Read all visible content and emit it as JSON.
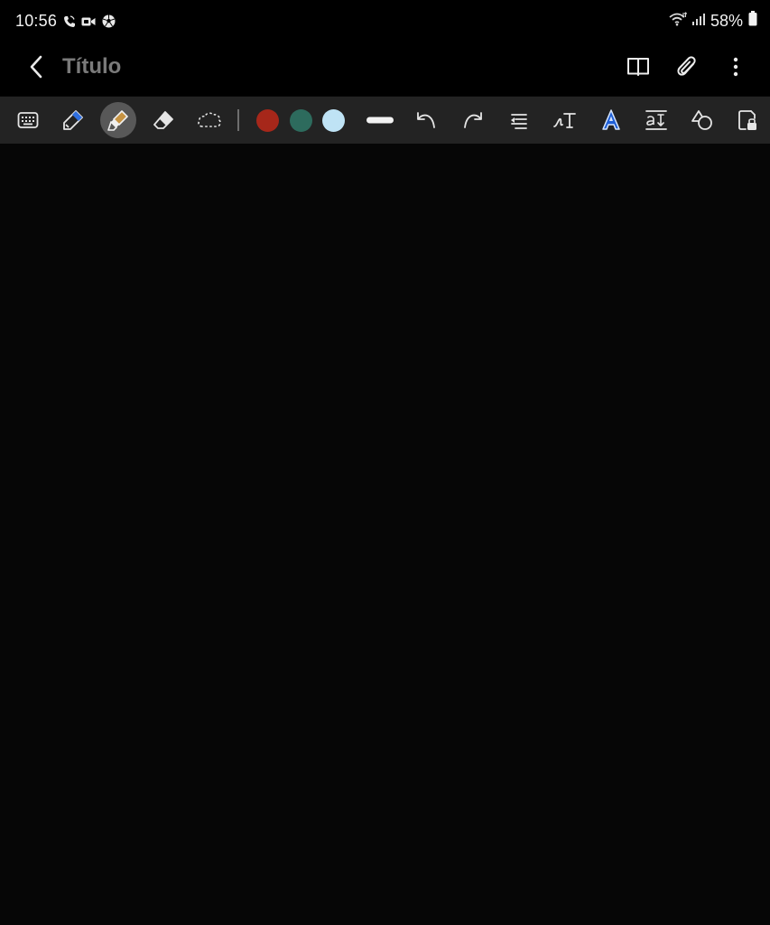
{
  "status_bar": {
    "time": "10:56",
    "battery_percent": "58%",
    "left_icons": [
      "wifi-call-icon",
      "video-call-icon",
      "soccer-ball-icon"
    ],
    "right_icons": [
      "wifi-icon",
      "signal-icon",
      "battery-icon"
    ]
  },
  "app_bar": {
    "title": "Título",
    "actions": [
      "book-view-icon",
      "attachment-icon",
      "more-options-icon"
    ]
  },
  "toolbar": {
    "tools": [
      {
        "name": "keyboard",
        "icon": "keyboard-icon"
      },
      {
        "name": "pen",
        "icon": "pen-icon"
      },
      {
        "name": "highlighter",
        "icon": "highlighter-icon",
        "selected": true
      },
      {
        "name": "eraser",
        "icon": "eraser-icon"
      },
      {
        "name": "lasso",
        "icon": "lasso-icon"
      },
      {
        "name": "undo",
        "icon": "undo-icon"
      },
      {
        "name": "redo",
        "icon": "redo-icon"
      },
      {
        "name": "text-align",
        "icon": "text-align-icon"
      },
      {
        "name": "handwriting-to-text",
        "icon": "handwriting-text-icon"
      },
      {
        "name": "text-style",
        "icon": "text-style-icon"
      },
      {
        "name": "text-format",
        "icon": "text-format-icon"
      },
      {
        "name": "shapes",
        "icon": "shapes-icon"
      },
      {
        "name": "lock",
        "icon": "lock-icon"
      }
    ],
    "colors": {
      "red": "#A6271A",
      "teal": "#2D6B5D",
      "light_blue": "#BFE3F5"
    },
    "stroke_width": "thick"
  },
  "theme": {
    "background": "#060606",
    "toolbar_background": "#232323",
    "selected_tool_background": "#585858",
    "title_color": "#7A7A7A"
  }
}
